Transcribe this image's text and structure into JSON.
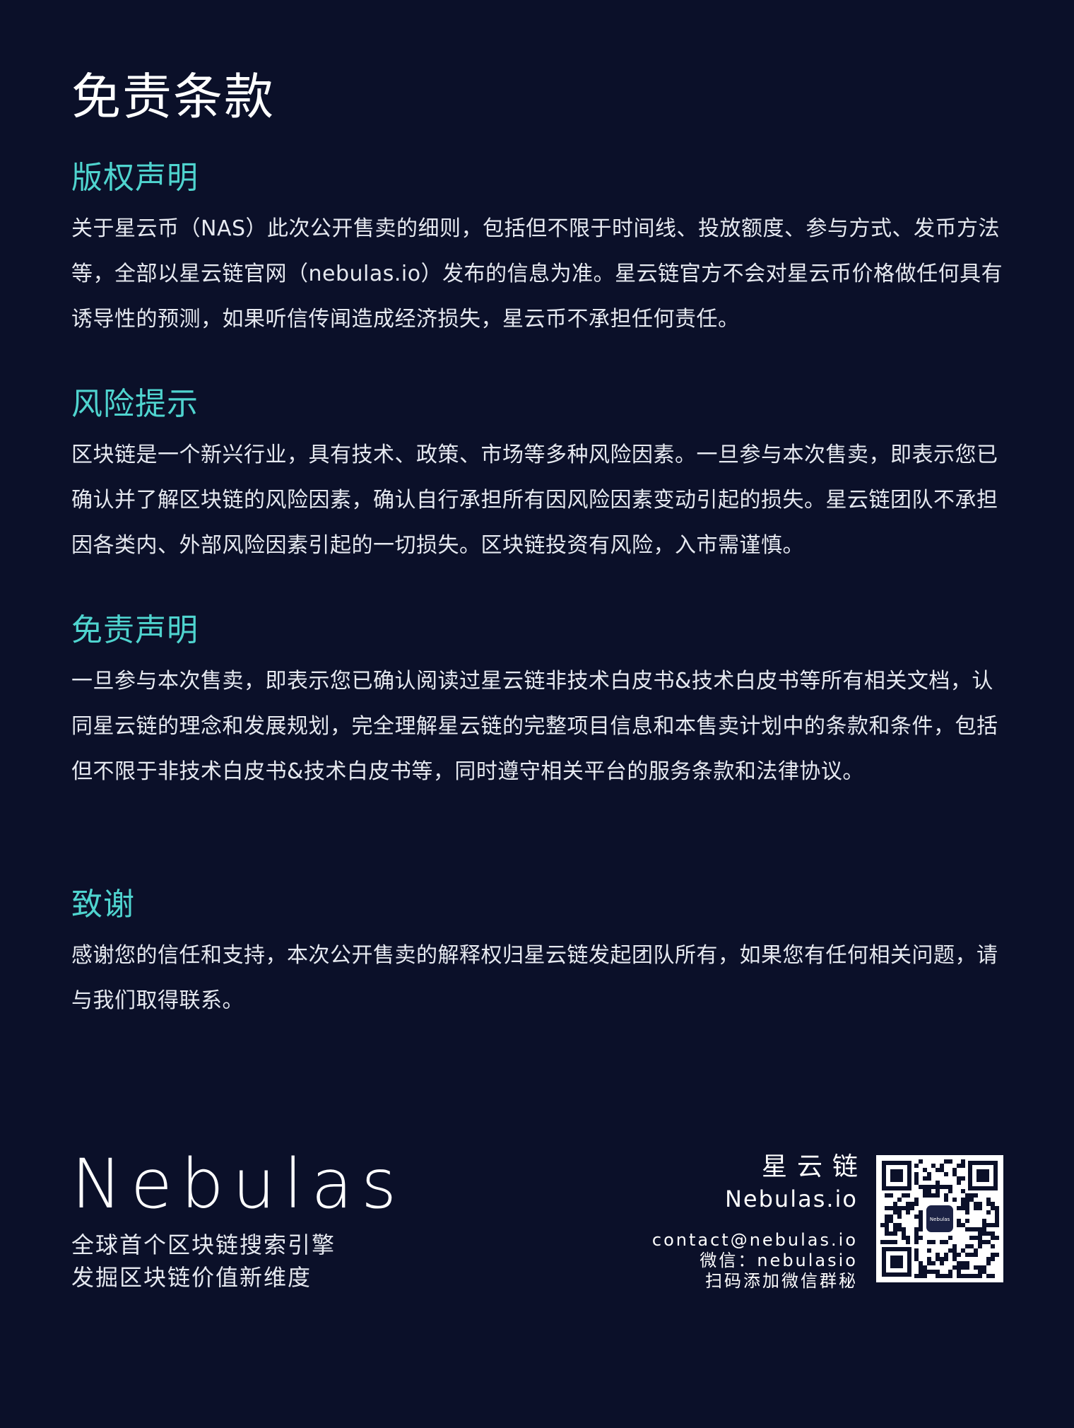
{
  "page_title": "免责条款",
  "sections": [
    {
      "heading": "版权声明",
      "body": "关于星云币（NAS）此次公开售卖的细则，包括但不限于时间线、投放额度、参与方式、发币方法等，全部以星云链官网（nebulas.io）发布的信息为准。星云链官方不会对星云币价格做任何具有诱导性的预测，如果听信传闻造成经济损失，星云币不承担任何责任。"
    },
    {
      "heading": "风险提示",
      "body": "区块链是一个新兴行业，具有技术、政策、市场等多种风险因素。一旦参与本次售卖，即表示您已确认并了解区块链的风险因素，确认自行承担所有因风险因素变动引起的损失。星云链团队不承担因各类内、外部风险因素引起的一切损失。区块链投资有风险，入市需谨慎。"
    },
    {
      "heading": "免责声明",
      "body": "一旦参与本次售卖，即表示您已确认阅读过星云链非技术白皮书&技术白皮书等所有相关文档，认同星云链的理念和发展规划，完全理解星云链的完整项目信息和本售卖计划中的条款和条件，包括但不限于非技术白皮书&技术白皮书等，同时遵守相关平台的服务条款和法律协议。"
    },
    {
      "heading": "致谢",
      "body": "感谢您的信任和支持，本次公开售卖的解释权归星云链发起团队所有，如果您有任何相关问题，请与我们取得联系。"
    }
  ],
  "footer": {
    "logo_text": "Nebulas",
    "slogan_line1": "全球首个区块链搜索引擎",
    "slogan_line2": "发掘区块链价值新维度",
    "cn_name": "星云链",
    "en_name": "Nebulas.io",
    "email": "contact@nebulas.io",
    "wechat": "微信：nebulasio",
    "qr_caption": "扫码添加微信群秘",
    "qr_center_label": "Nebulas"
  },
  "colors": {
    "background": "#0b1029",
    "heading_accent": "#4fd4cf",
    "text": "#e6e9f0"
  },
  "icons": [
    "qr-code-icon"
  ]
}
